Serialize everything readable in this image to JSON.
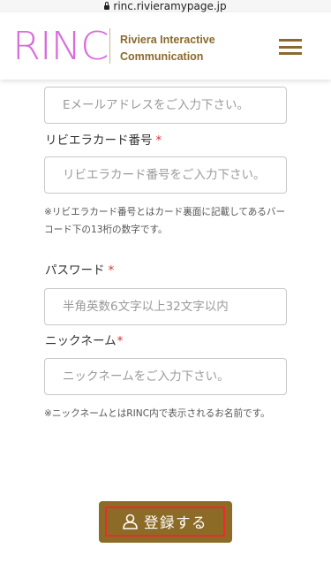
{
  "browser": {
    "url": "rinc.rivieramypage.jp"
  },
  "header": {
    "logo_text": "RINC",
    "tagline_line1": "Riviera Interactive",
    "tagline_line2": "Communication",
    "menu_icon": "hamburger-menu-icon"
  },
  "form": {
    "email": {
      "placeholder": "Eメールアドレスをご入力下さい。",
      "value": ""
    },
    "card": {
      "label": "リビエラカード番号",
      "required_mark": "*",
      "placeholder": "リビエラカード番号をご入力下さい。",
      "value": "",
      "note": "※リビエラカード番号とはカード裏面に記載してあるバーコード下の13桁の数字です。"
    },
    "password": {
      "label": "パスワード",
      "required_mark": "*",
      "placeholder": "半角英数6文字以上32文字以内",
      "value": ""
    },
    "nickname": {
      "label": "ニックネーム",
      "required_mark": "*",
      "placeholder": "ニックネームをご入力下さい。",
      "value": "",
      "note": "※ニックネームとはRINC内で表示されるお名前です。"
    },
    "submit_label": "登録する",
    "submit_icon": "user-icon"
  },
  "colors": {
    "logo": "#d86bdc",
    "brand_gold": "#8c6b27",
    "required": "#d93030",
    "highlight_border": "#ee2a2a"
  }
}
